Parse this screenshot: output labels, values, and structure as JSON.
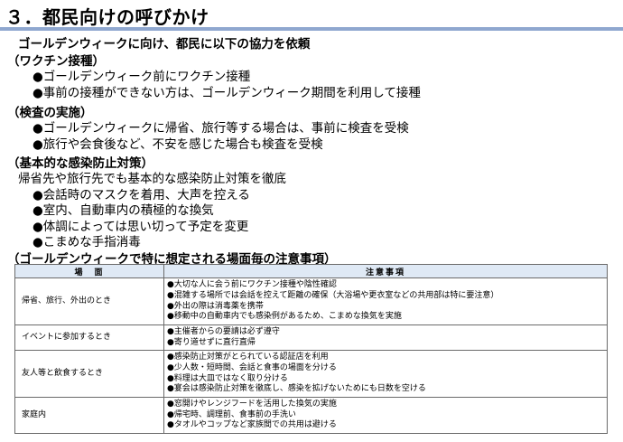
{
  "page": {
    "title": "３．都民向けの呼びかけ",
    "subtitle": "ゴールデンウィークに向け、都民に以下の協力を依頼"
  },
  "sections": [
    {
      "heading": "（ワクチン接種）",
      "lines": [
        "●ゴールデンウィーク前にワクチン接種",
        "●事前の接種ができない方は、ゴールデンウィーク期間を利用して接種"
      ]
    },
    {
      "heading": "（検査の実施）",
      "lines": [
        "●ゴールデンウィークに帰省、旅行等する場合は、事前に検査を受検",
        "●旅行や会食後など、不安を感じた場合も検査を受検"
      ]
    },
    {
      "heading": "（基本的な感染防止対策）",
      "intro": "帰省先や旅行先でも基本的な感染防止対策を徹底",
      "lines": [
        "●会話時のマスクを着用、大声を控える",
        "●室内、自動車内の積極的な換気",
        "●体調によっては思い切って予定を変更",
        "●こまめな手指消毒"
      ]
    }
  ],
  "table": {
    "title": "（ゴールデンウィークで特に想定される場面毎の注意事項）",
    "headers": [
      "場　面",
      "注意事項"
    ],
    "rows": [
      {
        "scene": "帰省、旅行、外出のとき",
        "notes": [
          "●大切な人に会う前にワクチン接種や陰性確認",
          "●混雑する場所では会話を控えて距離の確保（大浴場や更衣室などの共用部は特に要注意）",
          "●外出の際は消毒薬を携帯",
          "●移動中の自動車内でも感染例があるため、こまめな換気を実施"
        ]
      },
      {
        "scene": "イベントに参加するとき",
        "notes": [
          "●主催者からの要請は必ず遵守",
          "●寄り道せずに直行直帰"
        ]
      },
      {
        "scene": "友人等と飲食するとき",
        "notes": [
          "●感染防止対策がとられている認証店を利用",
          "●少人数・短時間、会話と食事の場面を分ける",
          "●料理は大皿ではなく取り分ける",
          "●宴会は感染防止対策を徹底し、感染を拡げないためにも日数を空ける"
        ]
      },
      {
        "scene": "家庭内",
        "notes": [
          "●窓開けやレンジフードを活用した換気の実施",
          "●帰宅時、調理前、食事前の手洗い",
          "●タオルやコップなど家族間での共用は避ける"
        ]
      }
    ]
  }
}
